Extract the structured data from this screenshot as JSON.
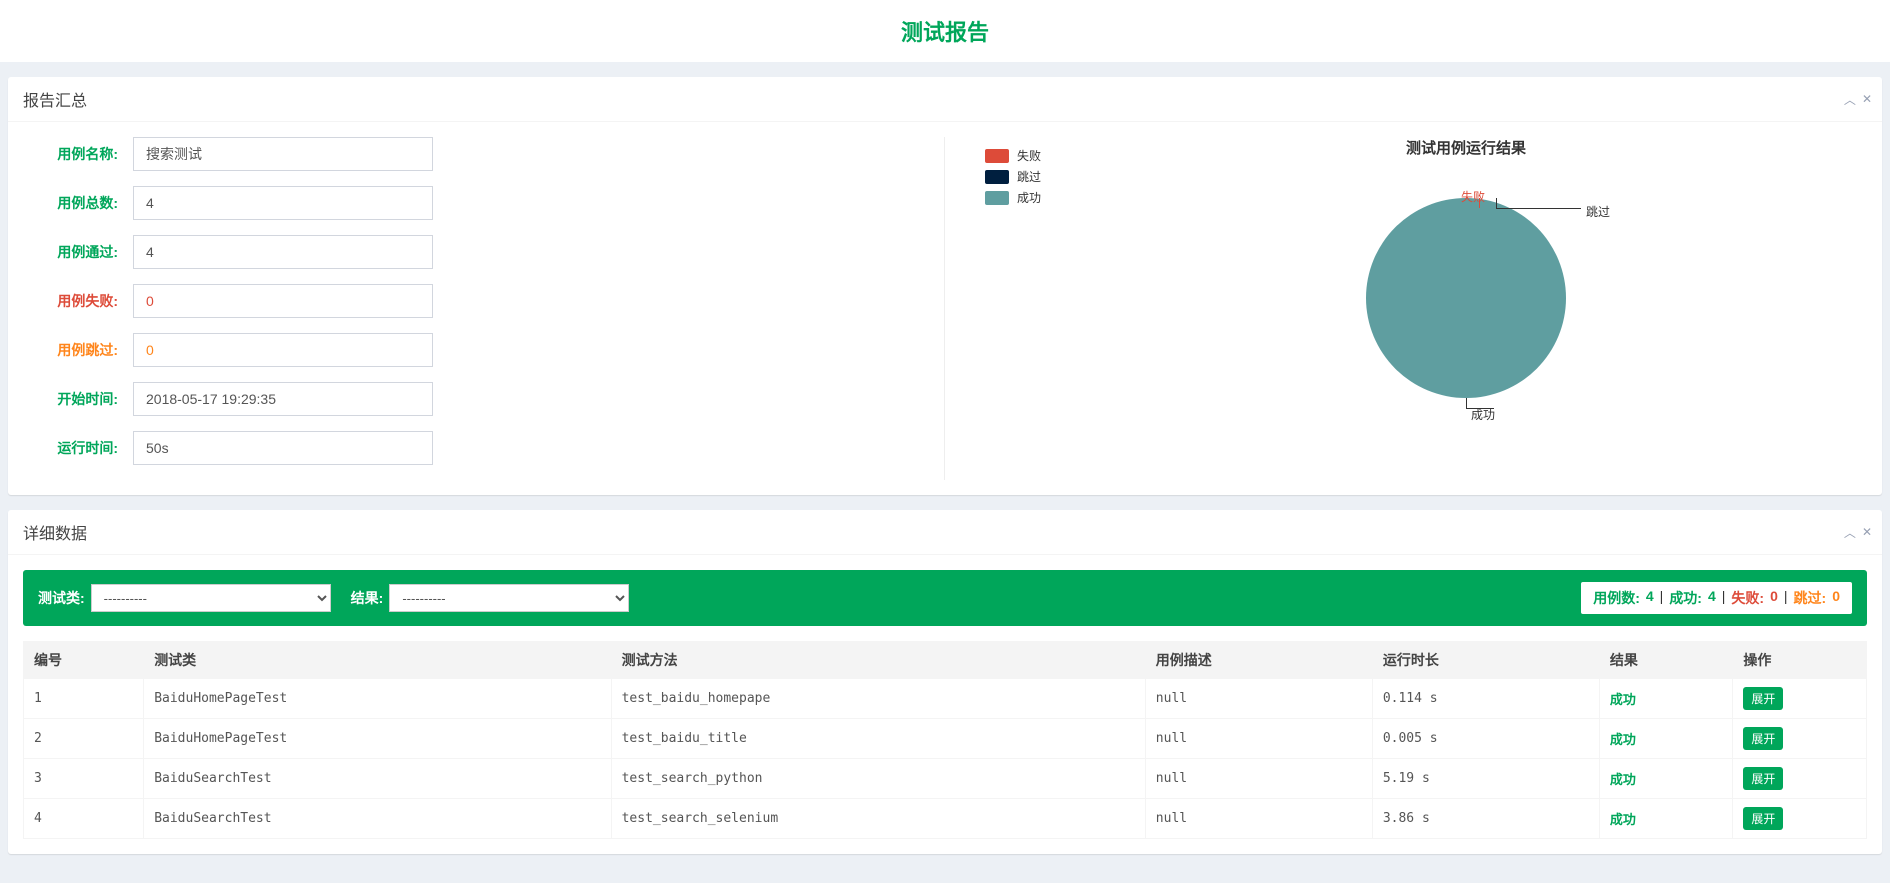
{
  "page": {
    "title": "测试报告"
  },
  "summary": {
    "header": "报告汇总",
    "labels": {
      "name": "用例名称:",
      "total": "用例总数:",
      "pass": "用例通过:",
      "fail": "用例失败:",
      "skip": "用例跳过:",
      "start": "开始时间:",
      "duration": "运行时间:"
    },
    "values": {
      "name": "搜索测试",
      "total": "4",
      "pass": "4",
      "fail": "0",
      "skip": "0",
      "start": "2018-05-17 19:29:35",
      "duration": "50s"
    }
  },
  "chart": {
    "legend": {
      "fail": "失败",
      "skip": "跳过",
      "success": "成功"
    },
    "title": "测试用例运行结果",
    "slice_labels": {
      "fail": "失败",
      "skip": "跳过",
      "success": "成功"
    },
    "colors": {
      "fail": "#dd4b39",
      "skip": "#001f3f",
      "success": "#5f9ea0"
    }
  },
  "chart_data": {
    "type": "pie",
    "title": "测试用例运行结果",
    "series": [
      {
        "name": "失败",
        "value": 0
      },
      {
        "name": "跳过",
        "value": 0
      },
      {
        "name": "成功",
        "value": 4
      }
    ]
  },
  "detail": {
    "header": "详细数据",
    "filter": {
      "class_label": "测试类:",
      "result_label": "结果:",
      "placeholder": "----------"
    },
    "stats": {
      "total_label": "用例数:",
      "total": "4",
      "success_label": "成功:",
      "success": "4",
      "fail_label": "失败:",
      "fail": "0",
      "skip_label": "跳过:",
      "skip": "0"
    },
    "columns": {
      "idx": "编号",
      "class": "测试类",
      "method": "测试方法",
      "desc": "用例描述",
      "duration": "运行时长",
      "result": "结果",
      "op": "操作"
    },
    "result_text": {
      "success": "成功"
    },
    "expand_label": "展开",
    "rows": [
      {
        "idx": "1",
        "class": "BaiduHomePageTest",
        "method": "test_baidu_homepape",
        "desc": "null",
        "duration": "0.114 s",
        "result": "success"
      },
      {
        "idx": "2",
        "class": "BaiduHomePageTest",
        "method": "test_baidu_title",
        "desc": "null",
        "duration": "0.005 s",
        "result": "success"
      },
      {
        "idx": "3",
        "class": "BaiduSearchTest",
        "method": "test_search_python",
        "desc": "null",
        "duration": "5.19 s",
        "result": "success"
      },
      {
        "idx": "4",
        "class": "BaiduSearchTest",
        "method": "test_search_selenium",
        "desc": "null",
        "duration": "3.86 s",
        "result": "success"
      }
    ]
  }
}
